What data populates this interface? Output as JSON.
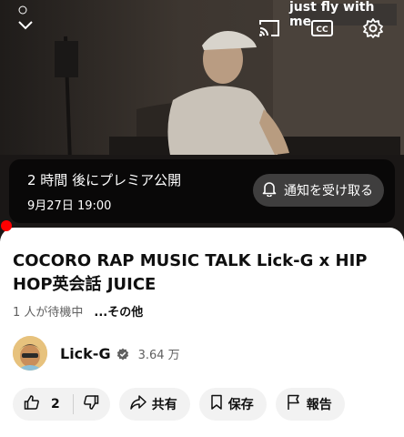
{
  "player": {
    "overlay_text": "just fly with me",
    "premiere_title": "2 時間 後にプレミア公開",
    "premiere_date": "9月27日 19:00",
    "notify_label": "通知を受け取る"
  },
  "video": {
    "title": "COCORO RAP MUSIC TALK Lick-G x HIP HOP英会話 JUICE",
    "waiting": "1 人が待機中",
    "more": "...その他"
  },
  "channel": {
    "name": "Lick-G",
    "subscribers": "3.64 万"
  },
  "actions": {
    "like_count": "2",
    "share_label": "共有",
    "save_label": "保存",
    "report_label": "報告"
  },
  "colors": {
    "accent": "#ff0000",
    "pill_bg": "#f2f2f2",
    "text_secondary": "#606060"
  }
}
